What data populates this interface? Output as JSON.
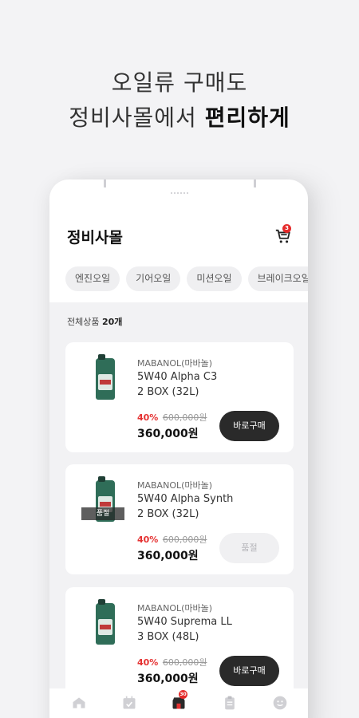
{
  "headline": {
    "line1": "오일류 구매도",
    "line2_prefix": "정비사몰에서 ",
    "line2_bold": "편리하게"
  },
  "app": {
    "title": "정비사몰",
    "cart_badge": "3"
  },
  "categories": [
    "엔진오일",
    "기어오일",
    "미션오일",
    "브레이크오일"
  ],
  "list": {
    "count_label": "전체상품",
    "count_value": "20개"
  },
  "products": [
    {
      "brand": "MABANOL(마바놀)",
      "name_line1": "5W40 Alpha C3",
      "name_line2": "2 BOX (32L)",
      "discount": "40%",
      "original_price": "600,000원",
      "price": "360,000원",
      "button": "바로구매",
      "sold_out": false
    },
    {
      "brand": "MABANOL(마바놀)",
      "name_line1": "5W40 Alpha Synth",
      "name_line2": "2 BOX (32L)",
      "discount": "40%",
      "original_price": "600,000원",
      "price": "360,000원",
      "button": "품절",
      "sold_out": true,
      "sold_out_tag": "품절"
    },
    {
      "brand": "MABANOL(마바놀)",
      "name_line1": "5W40 Suprema LL",
      "name_line2": "3 BOX (48L)",
      "discount": "40%",
      "original_price": "600,000원",
      "price": "360,000원",
      "button": "바로구매",
      "sold_out": false
    }
  ],
  "tabbar": {
    "items": [
      "home-icon",
      "calendar-icon",
      "shop-icon",
      "clipboard-icon",
      "profile-icon"
    ],
    "shop_badge": "30"
  },
  "colors": {
    "accent_red": "#e53232",
    "button_dark": "#2a2a2a",
    "background": "#f3f3f5"
  }
}
